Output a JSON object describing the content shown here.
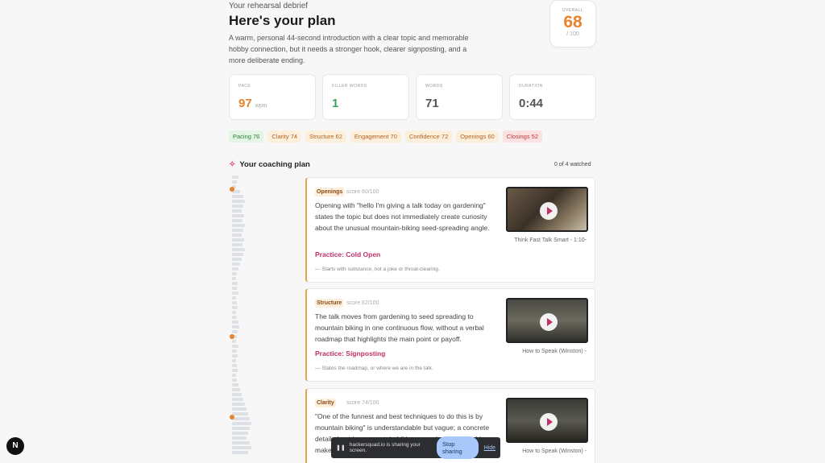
{
  "header": {
    "eyebrow": "Your rehearsal debrief",
    "title": "Here's your plan",
    "summary": "A warm, personal 44-second introduction with a clear topic and memorable hobby connection, but it needs a stronger hook, clearer signposting, and a more deliberate ending."
  },
  "overall": {
    "label": "OVERALL",
    "value": "68",
    "max": "/ 100",
    "color": "#e8832a"
  },
  "metrics": [
    {
      "label": "PACE",
      "value": "97",
      "unit": "wpm",
      "color": "#e8832a"
    },
    {
      "label": "FILLER WORDS",
      "value": "1",
      "color": "#3aa35a"
    },
    {
      "label": "WORDS",
      "value": "71",
      "color": "#555555"
    },
    {
      "label": "DURATION",
      "value": "0:44",
      "color": "#555555"
    }
  ],
  "chips": [
    {
      "label": "Pacing 76",
      "tone": "green"
    },
    {
      "label": "Clarity 74",
      "tone": "orange"
    },
    {
      "label": "Structure 62",
      "tone": "orange"
    },
    {
      "label": "Engagement 70",
      "tone": "orange"
    },
    {
      "label": "Confidence 72",
      "tone": "orange"
    },
    {
      "label": "Openings 60",
      "tone": "orange"
    },
    {
      "label": "Closings 52",
      "tone": "red"
    }
  ],
  "plan": {
    "title": "Your coaching plan",
    "icon": "sparkle-icon",
    "watched": "0 of 4 watched",
    "cards": [
      {
        "tag": "Openings",
        "score": "score 60/100",
        "body": "Opening with \"hello I'm giving a talk today on gardening\" states the topic but does not immediately create curiosity about the unusual mountain-biking seed-spreading angle.",
        "practice": "Practice: Cold Open",
        "note": "— Starts with substance, not a joke or throat-clearing.",
        "video_caption": "Think Fast Talk Smart - 1:10-"
      },
      {
        "tag": "Structure",
        "score": "score 62/100",
        "body": "The talk moves from gardening to seed spreading to mountain biking in one continuous flow, without a verbal roadmap that highlights the main point or payoff.",
        "practice": "Practice: Signposting",
        "note": "— States the roadmap, or where we are in the talk.",
        "video_caption": "How to Speak (Winston) -"
      },
      {
        "tag": "Clarity",
        "score": "score 74/100",
        "body": "\"One of the funnest and best techniques to do this is by mountain biking\" is understandable but vague; a concrete detail about how mountain biking spreads seeds would make it",
        "video_caption": "How to Speak (Winston) -"
      }
    ]
  },
  "share_bar": {
    "pause_icon": "pause-icon",
    "message": "hackersquad.io is sharing your screen.",
    "stop_label": "Stop sharing",
    "hide_label": "Hide"
  },
  "logo": {
    "letter": "N"
  }
}
